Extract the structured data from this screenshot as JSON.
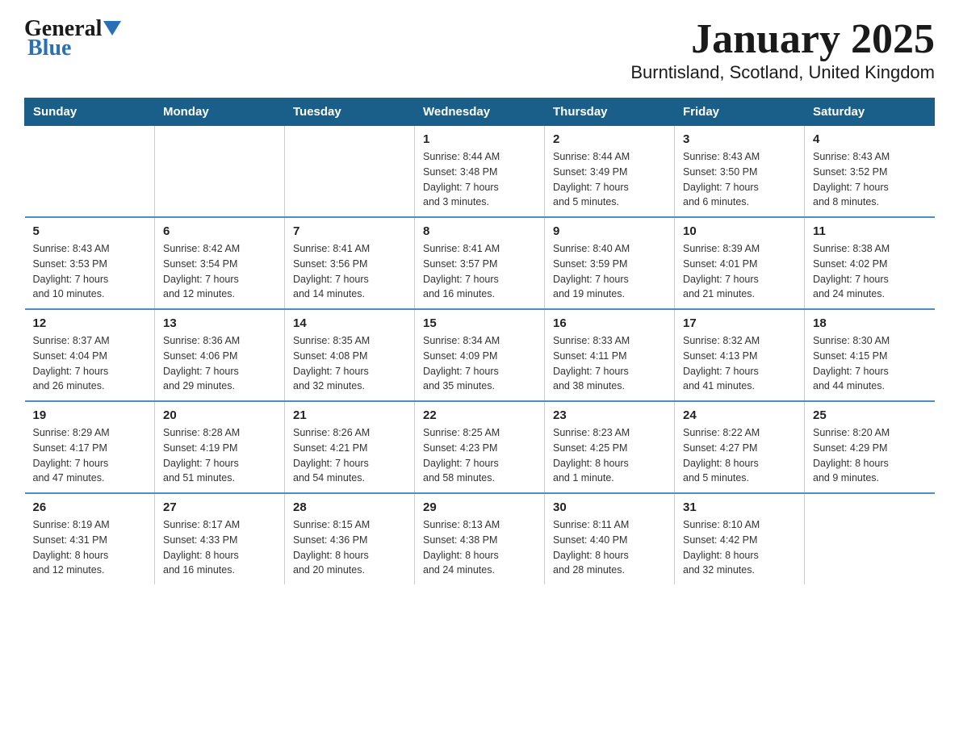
{
  "logo": {
    "general": "General",
    "blue": "Blue"
  },
  "title": "January 2025",
  "subtitle": "Burntisland, Scotland, United Kingdom",
  "weekdays": [
    "Sunday",
    "Monday",
    "Tuesday",
    "Wednesday",
    "Thursday",
    "Friday",
    "Saturday"
  ],
  "weeks": [
    [
      {
        "day": "",
        "info": ""
      },
      {
        "day": "",
        "info": ""
      },
      {
        "day": "",
        "info": ""
      },
      {
        "day": "1",
        "info": "Sunrise: 8:44 AM\nSunset: 3:48 PM\nDaylight: 7 hours\nand 3 minutes."
      },
      {
        "day": "2",
        "info": "Sunrise: 8:44 AM\nSunset: 3:49 PM\nDaylight: 7 hours\nand 5 minutes."
      },
      {
        "day": "3",
        "info": "Sunrise: 8:43 AM\nSunset: 3:50 PM\nDaylight: 7 hours\nand 6 minutes."
      },
      {
        "day": "4",
        "info": "Sunrise: 8:43 AM\nSunset: 3:52 PM\nDaylight: 7 hours\nand 8 minutes."
      }
    ],
    [
      {
        "day": "5",
        "info": "Sunrise: 8:43 AM\nSunset: 3:53 PM\nDaylight: 7 hours\nand 10 minutes."
      },
      {
        "day": "6",
        "info": "Sunrise: 8:42 AM\nSunset: 3:54 PM\nDaylight: 7 hours\nand 12 minutes."
      },
      {
        "day": "7",
        "info": "Sunrise: 8:41 AM\nSunset: 3:56 PM\nDaylight: 7 hours\nand 14 minutes."
      },
      {
        "day": "8",
        "info": "Sunrise: 8:41 AM\nSunset: 3:57 PM\nDaylight: 7 hours\nand 16 minutes."
      },
      {
        "day": "9",
        "info": "Sunrise: 8:40 AM\nSunset: 3:59 PM\nDaylight: 7 hours\nand 19 minutes."
      },
      {
        "day": "10",
        "info": "Sunrise: 8:39 AM\nSunset: 4:01 PM\nDaylight: 7 hours\nand 21 minutes."
      },
      {
        "day": "11",
        "info": "Sunrise: 8:38 AM\nSunset: 4:02 PM\nDaylight: 7 hours\nand 24 minutes."
      }
    ],
    [
      {
        "day": "12",
        "info": "Sunrise: 8:37 AM\nSunset: 4:04 PM\nDaylight: 7 hours\nand 26 minutes."
      },
      {
        "day": "13",
        "info": "Sunrise: 8:36 AM\nSunset: 4:06 PM\nDaylight: 7 hours\nand 29 minutes."
      },
      {
        "day": "14",
        "info": "Sunrise: 8:35 AM\nSunset: 4:08 PM\nDaylight: 7 hours\nand 32 minutes."
      },
      {
        "day": "15",
        "info": "Sunrise: 8:34 AM\nSunset: 4:09 PM\nDaylight: 7 hours\nand 35 minutes."
      },
      {
        "day": "16",
        "info": "Sunrise: 8:33 AM\nSunset: 4:11 PM\nDaylight: 7 hours\nand 38 minutes."
      },
      {
        "day": "17",
        "info": "Sunrise: 8:32 AM\nSunset: 4:13 PM\nDaylight: 7 hours\nand 41 minutes."
      },
      {
        "day": "18",
        "info": "Sunrise: 8:30 AM\nSunset: 4:15 PM\nDaylight: 7 hours\nand 44 minutes."
      }
    ],
    [
      {
        "day": "19",
        "info": "Sunrise: 8:29 AM\nSunset: 4:17 PM\nDaylight: 7 hours\nand 47 minutes."
      },
      {
        "day": "20",
        "info": "Sunrise: 8:28 AM\nSunset: 4:19 PM\nDaylight: 7 hours\nand 51 minutes."
      },
      {
        "day": "21",
        "info": "Sunrise: 8:26 AM\nSunset: 4:21 PM\nDaylight: 7 hours\nand 54 minutes."
      },
      {
        "day": "22",
        "info": "Sunrise: 8:25 AM\nSunset: 4:23 PM\nDaylight: 7 hours\nand 58 minutes."
      },
      {
        "day": "23",
        "info": "Sunrise: 8:23 AM\nSunset: 4:25 PM\nDaylight: 8 hours\nand 1 minute."
      },
      {
        "day": "24",
        "info": "Sunrise: 8:22 AM\nSunset: 4:27 PM\nDaylight: 8 hours\nand 5 minutes."
      },
      {
        "day": "25",
        "info": "Sunrise: 8:20 AM\nSunset: 4:29 PM\nDaylight: 8 hours\nand 9 minutes."
      }
    ],
    [
      {
        "day": "26",
        "info": "Sunrise: 8:19 AM\nSunset: 4:31 PM\nDaylight: 8 hours\nand 12 minutes."
      },
      {
        "day": "27",
        "info": "Sunrise: 8:17 AM\nSunset: 4:33 PM\nDaylight: 8 hours\nand 16 minutes."
      },
      {
        "day": "28",
        "info": "Sunrise: 8:15 AM\nSunset: 4:36 PM\nDaylight: 8 hours\nand 20 minutes."
      },
      {
        "day": "29",
        "info": "Sunrise: 8:13 AM\nSunset: 4:38 PM\nDaylight: 8 hours\nand 24 minutes."
      },
      {
        "day": "30",
        "info": "Sunrise: 8:11 AM\nSunset: 4:40 PM\nDaylight: 8 hours\nand 28 minutes."
      },
      {
        "day": "31",
        "info": "Sunrise: 8:10 AM\nSunset: 4:42 PM\nDaylight: 8 hours\nand 32 minutes."
      },
      {
        "day": "",
        "info": ""
      }
    ]
  ]
}
